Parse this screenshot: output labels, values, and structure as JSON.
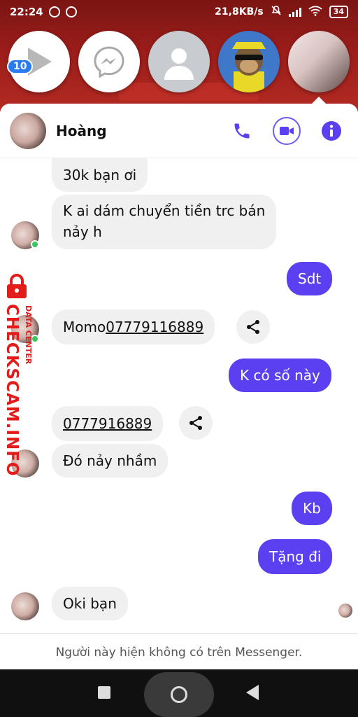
{
  "status_bar": {
    "time": "22:24",
    "net_speed": "21,8KB/s",
    "battery": "34"
  },
  "chat_heads": {
    "badge_count": "10"
  },
  "chat": {
    "contact_name": "Hoàng",
    "accent_color": "#5a40f0",
    "messages": [
      {
        "from": "them",
        "text": "30k bạn ơi"
      },
      {
        "from": "them",
        "text": "K ai dám chuyển tiền trc bán",
        "text2": "nảy h"
      },
      {
        "from": "me",
        "text": "Sdt"
      },
      {
        "from": "them",
        "text": "Momo ",
        "link": "07779116889"
      },
      {
        "from": "me",
        "text": "K có số này"
      },
      {
        "from": "them",
        "link": "0777916889"
      },
      {
        "from": "them",
        "text": "Đó nảy nhầm"
      },
      {
        "from": "me",
        "text": "Kb"
      },
      {
        "from": "me",
        "text": "Tặng đi"
      },
      {
        "from": "them",
        "text": "Oki bạn"
      }
    ],
    "footer_notice": "Người này hiện không có trên Messenger."
  },
  "watermark": {
    "brand": "CHECKSCAM.INFO",
    "sub": "DATA CENTER"
  }
}
